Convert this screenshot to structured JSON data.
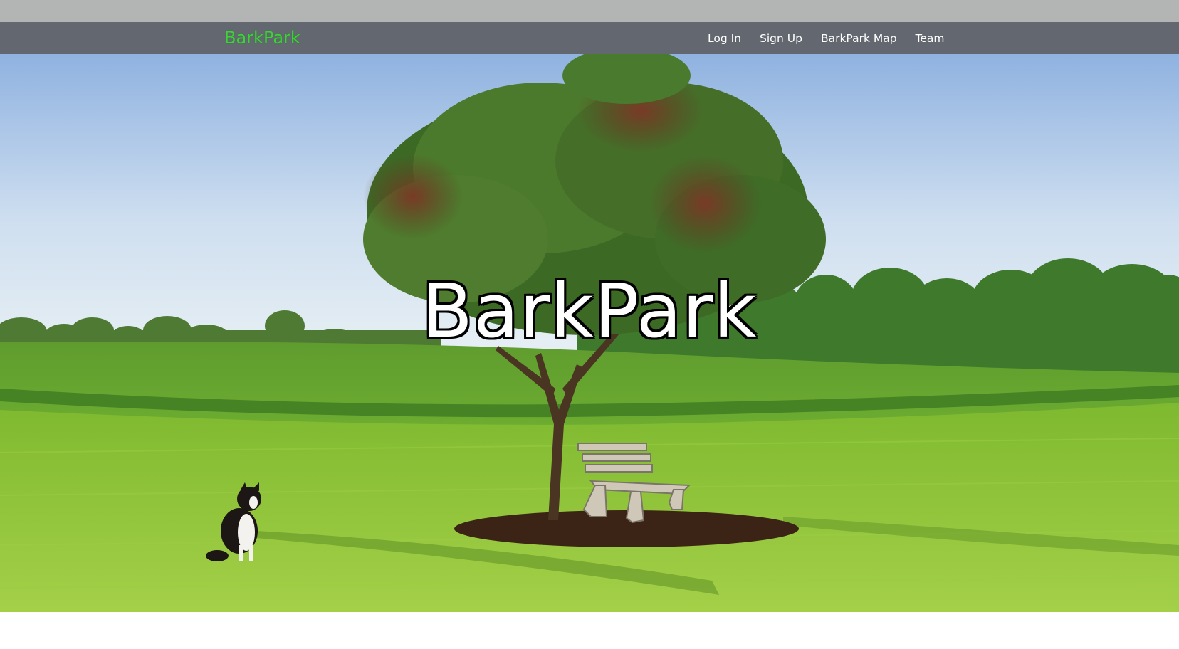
{
  "header": {
    "brand": "BarkPark",
    "nav": [
      {
        "label": "Log In"
      },
      {
        "label": "Sign Up"
      },
      {
        "label": "BarkPark Map"
      },
      {
        "label": "Team"
      }
    ]
  },
  "hero": {
    "title": "BarkPark"
  },
  "colors": {
    "navbar_bg": "#636870",
    "top_strip": "#b3b4b4",
    "brand": "#3ed23a",
    "sky_top": "#8fb2e0",
    "grass": "#86c43a"
  },
  "icons": {
    "hero_image": "park-scene-tree-bench-dog"
  }
}
